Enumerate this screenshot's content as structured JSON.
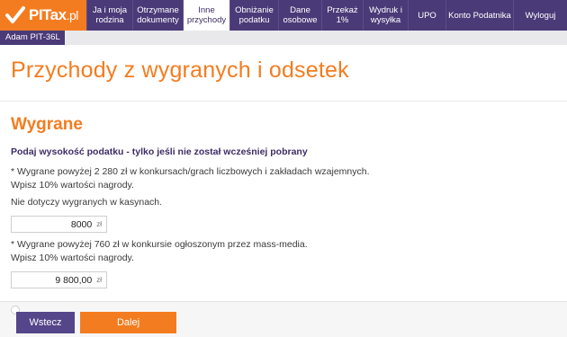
{
  "brand": {
    "name": "PITax",
    "suffix": ".pl"
  },
  "nav": [
    {
      "label": "Ja i moja rodzina",
      "active": false
    },
    {
      "label": "Otrzymane dokumenty",
      "active": false
    },
    {
      "label": "Inne przychody",
      "active": true
    },
    {
      "label": "Obniżanie podatku",
      "active": false
    },
    {
      "label": "Dane osobowe",
      "active": false
    },
    {
      "label": "Przekaż 1%",
      "active": false
    },
    {
      "label": "Wydruk i wysyłka",
      "active": false
    },
    {
      "label": "UPO",
      "active": false
    },
    {
      "label": "Konto Podatnika",
      "active": false
    },
    {
      "label": "Wyloguj",
      "active": false
    }
  ],
  "subtab": {
    "label": "Adam PIT-36L"
  },
  "page": {
    "title": "Przychody z wygranych i odsetek"
  },
  "section": {
    "title": "Wygrane",
    "instruction": "Podaj wysokość podatku - tylko jeśli nie został wcześniej pobrany",
    "note1_line1": "* Wygrane powyżej 2 280 zł w konkursach/grach liczbowych i zakładach wzajemnych.",
    "note1_line2": "Wpisz 10% wartości nagrody.",
    "note1_line3": "Nie dotyczy wygranych w kasynach.",
    "input1": {
      "value": "8000",
      "currency": "zł"
    },
    "note2_line1": "* Wygrane powyżej 760 zł w konkursie ogłoszonym przez mass-media.",
    "note2_line2": "Wpisz 10% wartości nagrody.",
    "input2": {
      "value": "9 800,00",
      "currency": "zł"
    }
  },
  "buttons": {
    "back": "Wstecz",
    "next": "Dalej"
  },
  "colors": {
    "brand_orange": "#f47c20",
    "nav_purple": "#4b3a78"
  }
}
